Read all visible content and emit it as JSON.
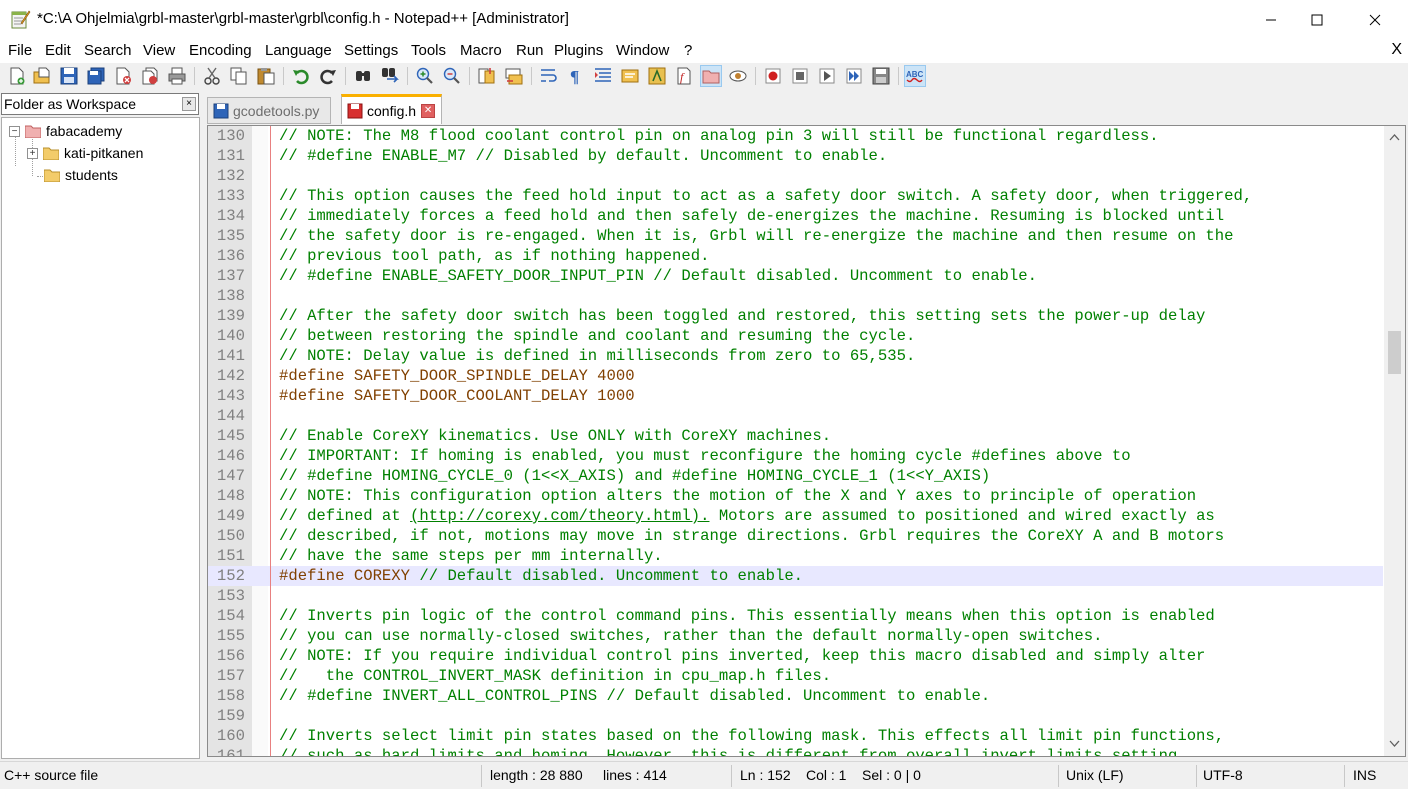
{
  "window": {
    "title": "*C:\\A Ohjelmia\\grbl-master\\grbl-master\\grbl\\config.h - Notepad++ [Administrator]"
  },
  "menu": {
    "items": [
      "File",
      "Edit",
      "Search",
      "View",
      "Encoding",
      "Language",
      "Settings",
      "Tools",
      "Macro",
      "Run",
      "Plugins",
      "Window",
      "?"
    ],
    "close_label": "X"
  },
  "toolbar": {
    "buttons": [
      "new-file-icon",
      "open-file-icon",
      "save-icon",
      "save-all-icon",
      "close-icon",
      "close-all-icon",
      "print-icon",
      "cut-icon",
      "copy-icon",
      "paste-icon",
      "undo-icon",
      "redo-icon",
      "find-icon",
      "replace-icon",
      "zoom-in-icon",
      "zoom-out-icon",
      "sync-vertical-icon",
      "sync-horizontal-icon",
      "word-wrap-icon",
      "show-all-chars-icon",
      "indent-guide-icon",
      "doc-map-icon",
      "function-list-icon",
      "folder-workspace-icon",
      "monitoring-icon",
      "record-macro-icon",
      "stop-record-icon",
      "play-macro-icon",
      "run-macro-multiple-icon",
      "save-macro-icon",
      "spell-check-icon"
    ]
  },
  "workspace": {
    "title": "Folder as Workspace",
    "close_label": "×",
    "tree": {
      "root": "fabacademy",
      "children": [
        "kati-pitkanen",
        "students"
      ]
    }
  },
  "tabs": [
    {
      "label": "gcodetools.py",
      "active": false
    },
    {
      "label": "config.h",
      "active": true
    }
  ],
  "editor": {
    "current_line": 152,
    "lines": [
      {
        "n": "130",
        "code": "// NOTE: The M8 flood coolant control pin on analog pin 3 will still be functional regardless.",
        "type": "comment"
      },
      {
        "n": "131",
        "code": "// #define ENABLE_M7 // Disabled by default. Uncomment to enable.",
        "type": "comment"
      },
      {
        "n": "132",
        "code": "",
        "type": "comment"
      },
      {
        "n": "133",
        "code": "// This option causes the feed hold input to act as a safety door switch. A safety door, when triggered,",
        "type": "comment"
      },
      {
        "n": "134",
        "code": "// immediately forces a feed hold and then safely de-energizes the machine. Resuming is blocked until",
        "type": "comment"
      },
      {
        "n": "135",
        "code": "// the safety door is re-engaged. When it is, Grbl will re-energize the machine and then resume on the",
        "type": "comment"
      },
      {
        "n": "136",
        "code": "// previous tool path, as if nothing happened.",
        "type": "comment"
      },
      {
        "n": "137",
        "code": "// #define ENABLE_SAFETY_DOOR_INPUT_PIN // Default disabled. Uncomment to enable.",
        "type": "comment"
      },
      {
        "n": "138",
        "code": "",
        "type": "comment"
      },
      {
        "n": "139",
        "code": "// After the safety door switch has been toggled and restored, this setting sets the power-up delay",
        "type": "comment"
      },
      {
        "n": "140",
        "code": "// between restoring the spindle and coolant and resuming the cycle.",
        "type": "comment"
      },
      {
        "n": "141",
        "code": "// NOTE: Delay value is defined in milliseconds from zero to 65,535.",
        "type": "comment"
      },
      {
        "n": "142",
        "code": "#define SAFETY_DOOR_SPINDLE_DELAY 4000",
        "type": "pre"
      },
      {
        "n": "143",
        "code": "#define SAFETY_DOOR_COOLANT_DELAY 1000",
        "type": "pre"
      },
      {
        "n": "144",
        "code": "",
        "type": "comment"
      },
      {
        "n": "145",
        "code": "// Enable CoreXY kinematics. Use ONLY with CoreXY machines.",
        "type": "comment"
      },
      {
        "n": "146",
        "code": "// IMPORTANT: If homing is enabled, you must reconfigure the homing cycle #defines above to",
        "type": "comment"
      },
      {
        "n": "147",
        "code": "// #define HOMING_CYCLE_0 (1<<X_AXIS) and #define HOMING_CYCLE_1 (1<<Y_AXIS)",
        "type": "comment"
      },
      {
        "n": "148",
        "code": "// NOTE: This configuration option alters the motion of the X and Y axes to principle of operation",
        "type": "comment"
      },
      {
        "n": "149",
        "code": "// defined at ",
        "url": "(http://corexy.com/theory.html).",
        "rest": " Motors are assumed to positioned and wired exactly as",
        "type": "url"
      },
      {
        "n": "150",
        "code": "// described, if not, motions may move in strange directions. Grbl requires the CoreXY A and B motors",
        "type": "comment"
      },
      {
        "n": "151",
        "code": "// have the same steps per mm internally.",
        "type": "comment"
      },
      {
        "n": "152",
        "pre": "#define COREXY",
        "code": " // Default disabled. Uncomment to enable.",
        "type": "mixed"
      },
      {
        "n": "153",
        "code": "",
        "type": "comment"
      },
      {
        "n": "154",
        "code": "// Inverts pin logic of the control command pins. This essentially means when this option is enabled",
        "type": "comment"
      },
      {
        "n": "155",
        "code": "// you can use normally-closed switches, rather than the default normally-open switches.",
        "type": "comment"
      },
      {
        "n": "156",
        "code": "// NOTE: If you require individual control pins inverted, keep this macro disabled and simply alter",
        "type": "comment"
      },
      {
        "n": "157",
        "code": "//   the CONTROL_INVERT_MASK definition in cpu_map.h files.",
        "type": "comment"
      },
      {
        "n": "158",
        "code": "// #define INVERT_ALL_CONTROL_PINS // Default disabled. Uncomment to enable.",
        "type": "comment"
      },
      {
        "n": "159",
        "code": "",
        "type": "comment"
      },
      {
        "n": "160",
        "code": "// Inverts select limit pin states based on the following mask. This effects all limit pin functions,",
        "type": "comment"
      },
      {
        "n": "161",
        "code": "// such as hard limits and homing. However, this is different from overall invert limits setting.",
        "type": "comment"
      }
    ]
  },
  "status": {
    "file_type": "C++ source file",
    "length": "length : 28 880",
    "lines": "lines : 414",
    "ln": "Ln : 152",
    "col": "Col : 1",
    "sel": "Sel : 0 | 0",
    "eol": "Unix (LF)",
    "encoding": "UTF-8",
    "mode": "INS"
  },
  "colors": {
    "comment": "#008000",
    "preprocessor": "#804000",
    "current_line": "#e8e8ff",
    "tab_accent": "#fab000"
  }
}
